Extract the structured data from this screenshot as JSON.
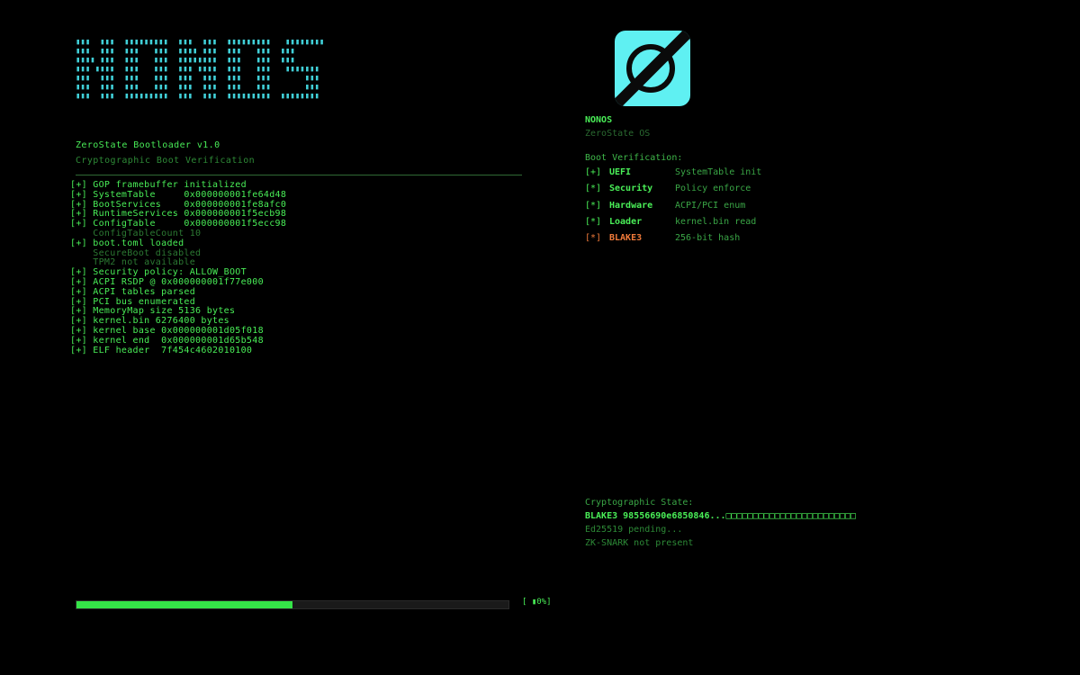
{
  "ascii_logo": "▮▮▮  ▮▮▮  ▮▮▮▮▮▮▮▮▮  ▮▮▮  ▮▮▮  ▮▮▮▮▮▮▮▮▮   ▮▮▮▮▮▮▮▮\n▮▮▮  ▮▮▮  ▮▮▮   ▮▮▮  ▮▮▮▮ ▮▮▮  ▮▮▮   ▮▮▮  ▮▮▮     \n▮▮▮▮ ▮▮▮  ▮▮▮   ▮▮▮  ▮▮▮▮▮▮▮▮  ▮▮▮   ▮▮▮  ▮▮▮     \n▮▮▮ ▮▮▮▮  ▮▮▮   ▮▮▮  ▮▮▮ ▮▮▮▮  ▮▮▮   ▮▮▮   ▮▮▮▮▮▮▮\n▮▮▮  ▮▮▮  ▮▮▮   ▮▮▮  ▮▮▮  ▮▮▮  ▮▮▮   ▮▮▮       ▮▮▮\n▮▮▮  ▮▮▮  ▮▮▮   ▮▮▮  ▮▮▮  ▮▮▮  ▮▮▮   ▮▮▮       ▮▮▮\n▮▮▮  ▮▮▮  ▮▮▮▮▮▮▮▮▮  ▮▮▮  ▮▮▮  ▮▮▮▮▮▮▮▮▮  ▮▮▮▮▮▮▮▮",
  "header": {
    "title": "ZeroState Bootloader v1.0",
    "subtitle": "Cryptographic Boot Verification"
  },
  "boot_log": [
    {
      "text": "[+] GOP framebuffer initialized",
      "kind": "ok"
    },
    {
      "text": "[+] SystemTable     0x000000001fe64d48",
      "kind": "ok"
    },
    {
      "text": "[+] BootServices    0x000000001fe8afc0",
      "kind": "ok"
    },
    {
      "text": "[+] RuntimeServices 0x000000001f5ecb98",
      "kind": "ok"
    },
    {
      "text": "[+] ConfigTable     0x000000001f5ecc98",
      "kind": "ok"
    },
    {
      "text": "    ConfigTableCount 10",
      "kind": "dim"
    },
    {
      "text": "[+] boot.toml loaded",
      "kind": "ok"
    },
    {
      "text": "    SecureBoot disabled",
      "kind": "dim"
    },
    {
      "text": "    TPM2 not available",
      "kind": "dim"
    },
    {
      "text": "[+] Security policy: ALLOW_BOOT",
      "kind": "ok"
    },
    {
      "text": "[+] ACPI RSDP @ 0x000000001f77e000",
      "kind": "ok"
    },
    {
      "text": "[+] ACPI tables parsed",
      "kind": "ok"
    },
    {
      "text": "[+] PCI bus enumerated",
      "kind": "ok"
    },
    {
      "text": "[+] MemoryMap size 5136 bytes",
      "kind": "ok"
    },
    {
      "text": "[+] kernel.bin 6276400 bytes",
      "kind": "ok"
    },
    {
      "text": "[+] kernel base 0x000000001d05f018",
      "kind": "ok"
    },
    {
      "text": "[+] kernel end  0x000000001d65b548",
      "kind": "ok"
    },
    {
      "text": "[+] ELF header  7f454c4602010100",
      "kind": "ok"
    }
  ],
  "progress": {
    "fraction": 0.5,
    "label": "[ ▮0%]"
  },
  "os": {
    "name": "NONOS",
    "subtitle": "ZeroState OS",
    "logo_icon": "slashed-zero-icon"
  },
  "verification": {
    "heading": "Boot Verification:",
    "items": [
      {
        "mark": "[+]",
        "name": "UEFI",
        "desc": "SystemTable init",
        "status": "ok"
      },
      {
        "mark": "[*]",
        "name": "Security",
        "desc": "Policy enforce",
        "status": "ok"
      },
      {
        "mark": "[*]",
        "name": "Hardware",
        "desc": "ACPI/PCI enum",
        "status": "ok"
      },
      {
        "mark": "[*]",
        "name": "Loader",
        "desc": "kernel.bin read",
        "status": "ok"
      },
      {
        "mark": "[*]",
        "name": "BLAKE3",
        "desc": "256-bit hash",
        "status": "warn"
      }
    ]
  },
  "crypto": {
    "heading": "Cryptographic State:",
    "blake": "BLAKE3 98556690e6850846...□□□□□□□□□□□□□□□□□□□□□□□□",
    "ed25519": "Ed25519 pending...",
    "zk": "ZK-SNARK not present"
  },
  "colors": {
    "background": "#000000",
    "primary_green": "#49ee57",
    "dim_green": "#2c7a33",
    "cyan": "#41d0d8",
    "warn_orange": "#f07a3a"
  }
}
